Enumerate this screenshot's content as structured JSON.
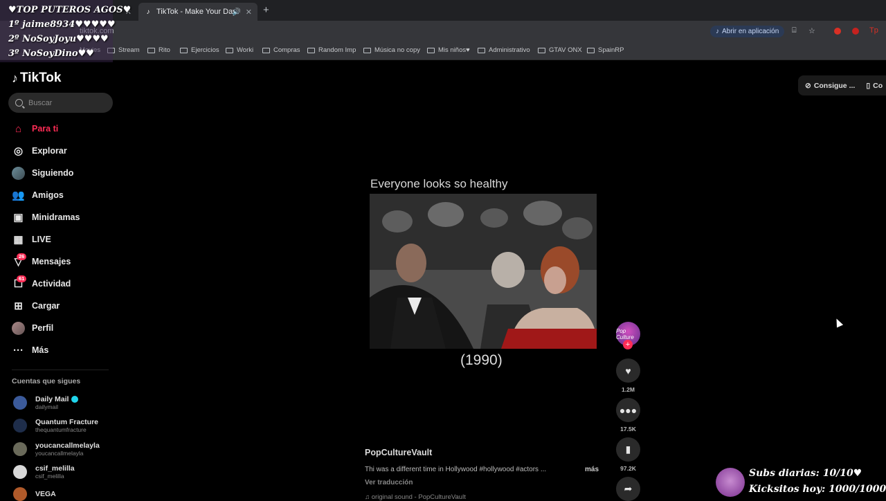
{
  "browser": {
    "tabs": [
      {
        "label": "",
        "active": false
      },
      {
        "label": "TikTok - Make Your Day",
        "active": true
      }
    ],
    "url": "tiktok.com",
    "open_app_label": "Abrir en aplicación",
    "bookmarks": [
      "Movies",
      "Stream",
      "Rito",
      "Ejercicios",
      "Worki",
      "Compras",
      "Random Imp",
      "Música no copy",
      "Mis niños♥",
      "Administrativo",
      "GTAV ONX",
      "SpainRP"
    ]
  },
  "overlay": {
    "lines": [
      "♥TOP PUTEROS AGOS♥",
      "1º jaime8934♥♥♥♥♥",
      "2º NoSoyJoyu♥♥♥♥",
      "3º NoSoyDino♥♥"
    ]
  },
  "sidebar": {
    "logo": "TikTok",
    "search_placeholder": "Buscar",
    "items": [
      {
        "label": "Para ti",
        "icon": "home-icon"
      },
      {
        "label": "Explorar",
        "icon": "compass-icon"
      },
      {
        "label": "Siguiendo",
        "icon": "following-avatar-icon"
      },
      {
        "label": "Amigos",
        "icon": "friends-icon"
      },
      {
        "label": "Minidramas",
        "icon": "minidramas-icon"
      },
      {
        "label": "LIVE",
        "icon": "live-icon"
      },
      {
        "label": "Mensajes",
        "icon": "messages-icon",
        "badge": "26"
      },
      {
        "label": "Actividad",
        "icon": "activity-icon",
        "badge": "61"
      },
      {
        "label": "Cargar",
        "icon": "upload-icon"
      },
      {
        "label": "Perfil",
        "icon": "profile-avatar-icon"
      },
      {
        "label": "Más",
        "icon": "more-icon"
      }
    ],
    "following_title": "Cuentas que sigues",
    "accounts": [
      {
        "name": "Daily Mail",
        "handle": "dailymail",
        "verified": true
      },
      {
        "name": "Quantum Fracture",
        "handle": "thequantumfracture"
      },
      {
        "name": "youcancallmelayla",
        "handle": "youcancallmelayla"
      },
      {
        "name": "csif_melilla",
        "handle": "csif_melilla"
      },
      {
        "name": "VEGA",
        "handle": ""
      }
    ]
  },
  "header": {
    "get_button_label": "Consigue ...",
    "cut_label": "Co"
  },
  "video": {
    "caption_top": "Everyone looks so healthy",
    "caption_bottom": "(1990)",
    "likes": "1.2M",
    "comments": "17.5K",
    "saves": "97.2K",
    "creator_avatar_text": "Pop Culture",
    "author": "PopCultureVault",
    "description": "Thi was a different time in Hollywood #hollywood #actors ...",
    "more_label": "más",
    "translate_label": "Ver traducción",
    "sound": "original sound - PopCultureVault"
  },
  "stream": {
    "subs": "Subs diarias: 10/10♥",
    "kicks": "Kicksitos hoy: 1000/1000♥"
  }
}
